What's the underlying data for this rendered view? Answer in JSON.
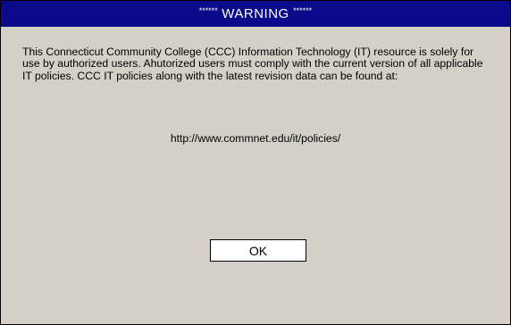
{
  "dialog": {
    "title_prefix": "******",
    "title_text": "WARNING",
    "title_suffix": "******",
    "message": "This Connecticut Community College (CCC) Information Technology (IT) resource is solely for use by authorized users. Ahutorized users must comply with the current version of all applicable IT policies. CCC IT policies along with the latest revision data can be found at:",
    "url": "http://www.commnet.edu/it/policies/",
    "ok_label": "OK"
  },
  "colors": {
    "title_bar": "#0a0a8a",
    "dialog_background": "#d4d0c8",
    "button_background": "#ffffff"
  }
}
